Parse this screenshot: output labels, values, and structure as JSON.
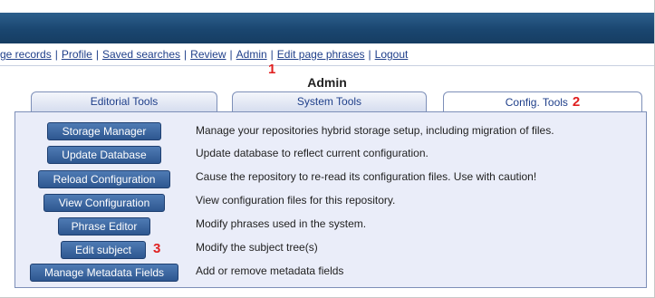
{
  "nav": {
    "links": [
      "ge records",
      "Profile",
      "Saved searches",
      "Review",
      "Admin",
      "Edit page phrases",
      "Logout"
    ],
    "separator": "|"
  },
  "page": {
    "title": "Admin"
  },
  "tabs": [
    {
      "label": "Editorial Tools",
      "active": false
    },
    {
      "label": "System Tools",
      "active": false
    },
    {
      "label": "Config. Tools",
      "active": true
    }
  ],
  "annotations": [
    "1",
    "2",
    "3"
  ],
  "tools": [
    {
      "button": "Storage Manager",
      "description": "Manage your repositories hybrid storage setup, including migration of files."
    },
    {
      "button": "Update Database",
      "description": "Update database to reflect current configuration."
    },
    {
      "button": "Reload Configuration",
      "description": "Cause the repository to re-read its configuration files. Use with caution!"
    },
    {
      "button": "View Configuration",
      "description": "View configuration files for this repository."
    },
    {
      "button": "Phrase Editor",
      "description": "Modify phrases used in the system."
    },
    {
      "button": "Edit subject",
      "description": "Modify the subject tree(s)"
    },
    {
      "button": "Manage Metadata Fields",
      "description": "Add or remove metadata fields"
    }
  ],
  "colors": {
    "banner": "#1a4670",
    "link": "#1f3f8a",
    "button": "#2e5790",
    "panel": "#eaedf9",
    "annotation": "#e02020"
  }
}
